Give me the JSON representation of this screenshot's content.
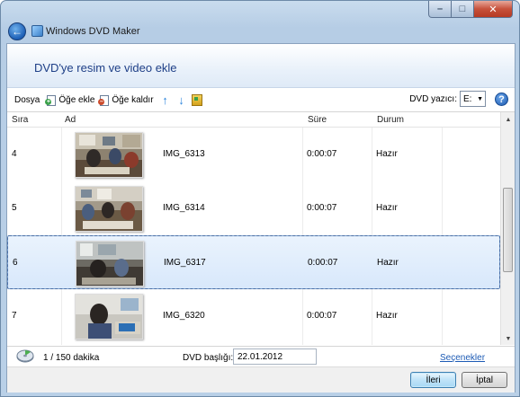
{
  "window": {
    "title": "Windows DVD Maker",
    "controls": {
      "minimize": "–",
      "maximize": "□",
      "close": "✕"
    }
  },
  "page": {
    "heading": "DVD'ye resim ve video ekle"
  },
  "toolbar": {
    "file_label": "Dosya",
    "add_items_label": "Öğe ekle",
    "remove_items_label": "Öğe kaldır",
    "drive_label": "DVD yazıcı:",
    "drive_value": "E:",
    "help": "?"
  },
  "grid": {
    "columns": {
      "order": "Sıra",
      "name": "Ad",
      "duration": "Süre",
      "status": "Durum"
    },
    "rows": [
      {
        "order": "4",
        "name": "IMG_6313",
        "duration": "0:00:07",
        "status": "Hazır",
        "selected": false
      },
      {
        "order": "5",
        "name": "IMG_6314",
        "duration": "0:00:07",
        "status": "Hazır",
        "selected": false
      },
      {
        "order": "6",
        "name": "IMG_6317",
        "duration": "0:00:07",
        "status": "Hazır",
        "selected": true
      },
      {
        "order": "7",
        "name": "IMG_6320",
        "duration": "0:00:07",
        "status": "Hazır",
        "selected": false
      }
    ]
  },
  "status": {
    "disc_usage": "1 / 150 dakika",
    "disc_title_label": "DVD başlığı:",
    "disc_title_value": "22.01.2012",
    "options_link": "Seçenekler"
  },
  "buttons": {
    "next": "İleri",
    "cancel": "İptal"
  },
  "colors": {
    "accent": "#1e3f87",
    "link": "#1d5bb5",
    "selection": "#d8e8fb"
  }
}
